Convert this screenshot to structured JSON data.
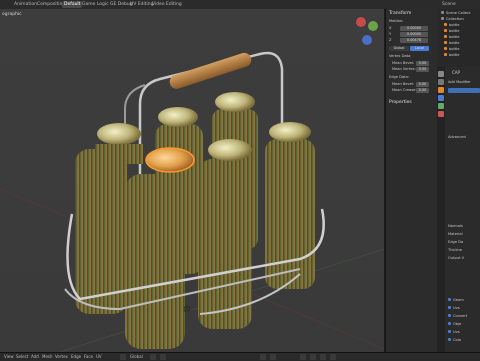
{
  "topbar": {
    "tabs": [
      "Animation",
      "Compositing",
      "Default",
      "Game Logic",
      "GE Debug",
      "UV Editing",
      "Video Editing"
    ],
    "active_tab": "Default",
    "scene_label": "Scene"
  },
  "viewport": {
    "label": "ographic"
  },
  "npanel": {
    "transform_header": "Transform",
    "median_label": "Median:",
    "fields": [
      {
        "axis": "X",
        "value": "0.00000"
      },
      {
        "axis": "Y",
        "value": "0.00000"
      },
      {
        "axis": "Z",
        "value": "0.00478"
      }
    ],
    "global_label": "Global",
    "local_label": "Local",
    "vertex_data_label": "Vertex Data:",
    "mean_bevel_label": "Mean Bevel:",
    "mean_bevel_value": "0.00",
    "mean_vertex_label": "Mean Vertex:",
    "mean_vertex_value": "0.00",
    "edge_data_label": "Edge Data:",
    "mean_bevel2_label": "Mean Bevel:",
    "mean_bevel2_value": "0.00",
    "mean_crease_label": "Mean Crease:",
    "mean_crease_value": "0.00",
    "properties_header": "Properties"
  },
  "outliner": {
    "rows": [
      "Scene Collect",
      "Collection",
      "bottle",
      "bottle",
      "bottle",
      "bottle",
      "bottle",
      "bottle"
    ]
  },
  "properties": {
    "object_name": "CAP",
    "add_modifier": "Add Modifier",
    "rows": [
      "Advanced",
      "Normals",
      "Material",
      "Edge Da",
      "Thickne",
      "Output V",
      "Geom",
      "Uvs",
      "Convert",
      "Obje",
      "Uvs",
      "Colo"
    ]
  },
  "bottombar": {
    "menu": [
      "View",
      "Select",
      "Add",
      "Mesh",
      "Vertex",
      "Edge",
      "Face",
      "UV"
    ],
    "mode": "Global"
  },
  "colors": {
    "accent": "#4b7bd1",
    "selection": "#e08a2c"
  }
}
